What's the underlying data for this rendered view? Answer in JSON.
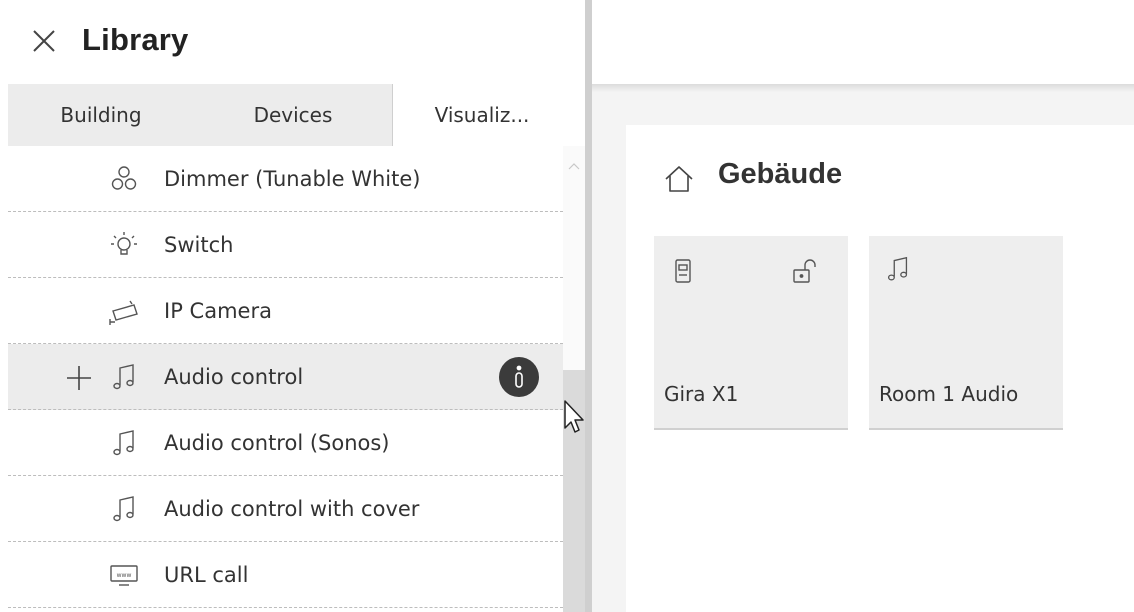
{
  "library": {
    "title": "Library",
    "close_icon": "close-x-icon",
    "tabs": [
      {
        "label": "Building",
        "active": false
      },
      {
        "label": "Devices",
        "active": false
      },
      {
        "label": "Visualiz...",
        "active": true
      }
    ],
    "items": [
      {
        "label": "Dimmer (Tunable White)",
        "icon": "tunable-white-icon"
      },
      {
        "label": "Switch",
        "icon": "light-bulb-icon"
      },
      {
        "label": "IP Camera",
        "icon": "ip-camera-icon"
      },
      {
        "label": "Audio control",
        "icon": "music-note-icon",
        "hovered": true
      },
      {
        "label": "Audio control (Sonos)",
        "icon": "music-note-icon"
      },
      {
        "label": "Audio control with cover",
        "icon": "music-note-icon"
      },
      {
        "label": "URL call",
        "icon": "url-www-icon"
      }
    ]
  },
  "canvas": {
    "section_title": "Gebäude",
    "section_icon": "house-icon",
    "tiles": [
      {
        "label": "Gira X1",
        "icons": [
          "device-icon",
          "unlocked-padlock-icon"
        ]
      },
      {
        "label": "Room 1 Audio",
        "icons": [
          "music-note-icon"
        ]
      }
    ]
  },
  "colors": {
    "info_badge": "#3b3b3b",
    "hover_row": "#ececec",
    "tile_bg": "#eeeeee",
    "canvas_bg": "#f4f4f4"
  }
}
